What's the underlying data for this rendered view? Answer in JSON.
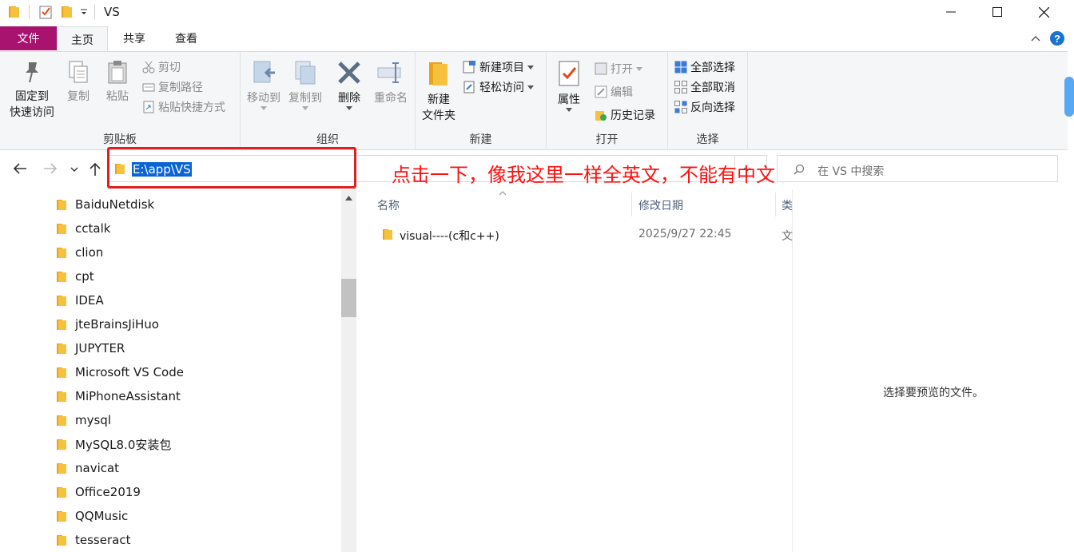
{
  "window": {
    "title": "VS"
  },
  "tabs": {
    "file": "文件",
    "home": "主页",
    "share": "共享",
    "view": "查看"
  },
  "clipboard": {
    "pin_line1": "固定到",
    "pin_line2": "快速访问",
    "copy": "复制",
    "paste": "粘贴",
    "cut": "剪切",
    "copy_path": "复制路径",
    "paste_shortcut": "粘贴快捷方式",
    "label": "剪贴板"
  },
  "organize": {
    "move_to": "移动到",
    "copy_to": "复制到",
    "delete": "删除",
    "rename": "重命名",
    "label": "组织"
  },
  "new": {
    "new_folder_line1": "新建",
    "new_folder_line2": "文件夹",
    "new_item": "新建项目",
    "easy_access": "轻松访问",
    "label": "新建"
  },
  "open": {
    "properties": "属性",
    "open": "打开",
    "edit": "编辑",
    "history": "历史记录",
    "label": "打开"
  },
  "select": {
    "select_all": "全部选择",
    "select_none": "全部取消",
    "invert": "反向选择",
    "label": "选择"
  },
  "address": {
    "path": "E:\\app\\VS"
  },
  "annotation": "点击一下，像我这里一样全英文，不能有中文",
  "search": {
    "placeholder": "在 VS 中搜索"
  },
  "nav_items": [
    "BaiduNetdisk",
    "cctalk",
    "clion",
    "cpt",
    "IDEA",
    "jteBrainsJiHuo",
    "JUPYTER",
    "Microsoft VS Code",
    "MiPhoneAssistant",
    "mysql",
    "MySQL8.0安装包",
    "navicat",
    "Office2019",
    "QQMusic",
    "tesseract"
  ],
  "columns": {
    "name": "名称",
    "date": "修改日期",
    "type": "类"
  },
  "files": [
    {
      "name": "visual----(c和c++)",
      "date": "2025/9/27 22:45",
      "type": "文"
    }
  ],
  "preview": {
    "message": "选择要预览的文件。"
  },
  "colors": {
    "file_tab": "#a8136f",
    "selection": "#0a64d4",
    "annotation": "#ff1010",
    "folder": "#f6c23e"
  }
}
